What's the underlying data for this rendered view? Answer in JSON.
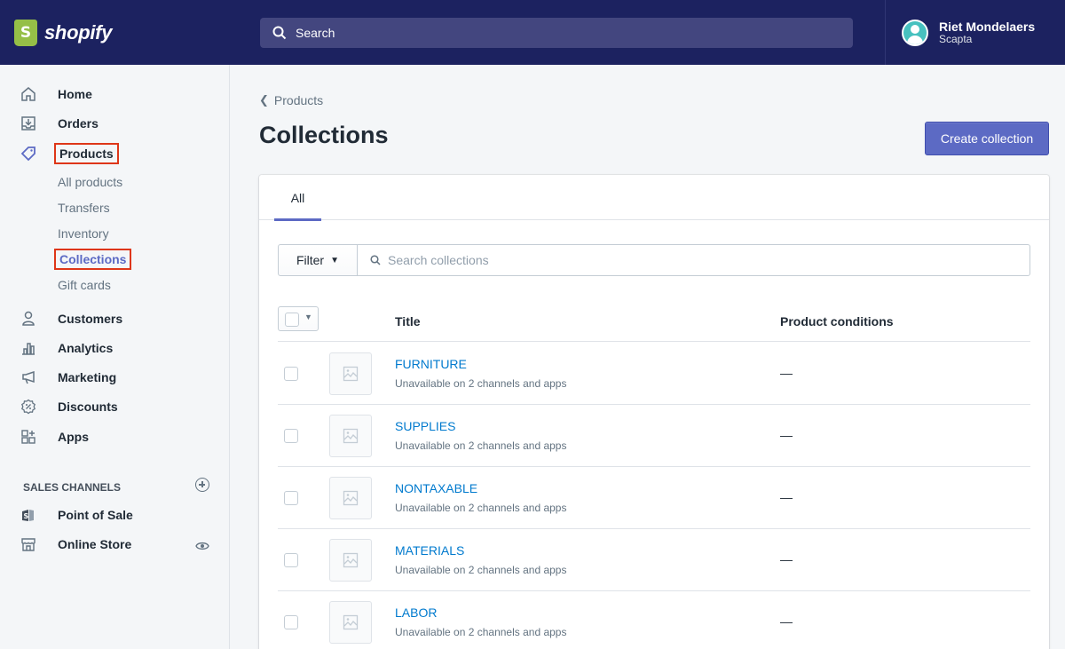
{
  "brand": {
    "name": "shopify",
    "logo_letter": "S",
    "logo_color": "#95bf47"
  },
  "topbar": {
    "search_label": "Search",
    "bg_color": "#1c2260"
  },
  "user": {
    "name": "Riet Mondelaers",
    "store": "Scapta"
  },
  "sidebar": {
    "nav": [
      {
        "label": "Home",
        "icon": "home-icon"
      },
      {
        "label": "Orders",
        "icon": "orders-icon"
      },
      {
        "label": "Products",
        "icon": "tag-icon"
      }
    ],
    "product_sub": [
      "All products",
      "Transfers",
      "Inventory",
      "Collections",
      "Gift cards"
    ],
    "nav2": [
      {
        "label": "Customers",
        "icon": "customers-icon"
      },
      {
        "label": "Analytics",
        "icon": "analytics-icon"
      },
      {
        "label": "Marketing",
        "icon": "marketing-icon"
      },
      {
        "label": "Discounts",
        "icon": "discounts-icon"
      },
      {
        "label": "Apps",
        "icon": "apps-icon"
      }
    ],
    "sales_channels_heading": "SALES CHANNELS",
    "channels": [
      {
        "label": "Point of Sale",
        "icon": "pos-icon"
      },
      {
        "label": "Online Store",
        "icon": "store-icon"
      }
    ]
  },
  "main": {
    "breadcrumb": "Products",
    "title": "Collections",
    "create_button": "Create collection",
    "tab": "All",
    "filter_label": "Filter",
    "search_placeholder": "Search collections",
    "columns": {
      "title": "Title",
      "conditions": "Product conditions"
    },
    "rows": [
      {
        "name": "FURNITURE",
        "sub": "Unavailable on 2 channels and apps",
        "cond": "—"
      },
      {
        "name": "SUPPLIES",
        "sub": "Unavailable on 2 channels and apps",
        "cond": "—"
      },
      {
        "name": "NONTAXABLE",
        "sub": "Unavailable on 2 channels and apps",
        "cond": "—"
      },
      {
        "name": "MATERIALS",
        "sub": "Unavailable on 2 channels and apps",
        "cond": "—"
      },
      {
        "name": "LABOR",
        "sub": "Unavailable on 2 channels and apps",
        "cond": "—"
      }
    ]
  },
  "colors": {
    "accent": "#5c6ac4",
    "link": "#007ace",
    "highlight": "#de3618"
  }
}
